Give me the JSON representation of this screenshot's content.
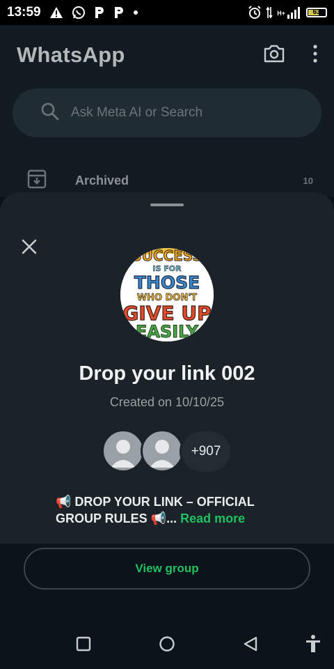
{
  "status_bar": {
    "time": "13:59",
    "battery_level": "63",
    "battery_fraction": 0.63,
    "left_icons": [
      "warning-icon",
      "whatsapp-icon",
      "p-icon",
      "p-icon",
      "dot-icon"
    ],
    "right_icons": [
      "alarm-icon",
      "data-arrows-icon",
      "signal-icon",
      "battery-icon"
    ],
    "network_label": "H+"
  },
  "header": {
    "title": "WhatsApp",
    "actions": [
      "camera-icon",
      "more-vert-icon"
    ]
  },
  "search": {
    "placeholder": "Ask Meta AI or Search"
  },
  "archived": {
    "label": "Archived",
    "count": "10"
  },
  "sheet": {
    "group_name": "Drop your link 002",
    "created": "Created on 10/10/25",
    "members_more": "+907",
    "description": "📢 DROP YOUR LINK – OFFICIAL GROUP RULES 📢...",
    "read_more": "Read more",
    "avatar_image_text": "SUCCESS IS FOR THOSE WHO DON'T GIVE UP EASILY"
  },
  "view_group_label": "View group",
  "colors": {
    "accent_green": "#21c063",
    "sheet_bg": "#1b2328",
    "app_bg": "#0b141a"
  }
}
